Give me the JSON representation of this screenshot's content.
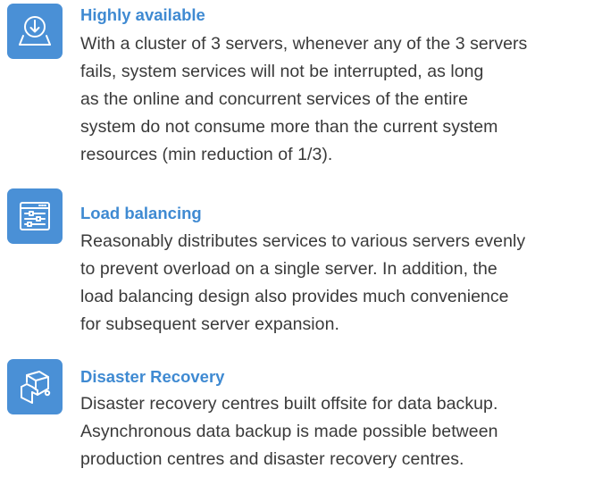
{
  "features": [
    {
      "icon": "download-tray-icon",
      "title": "Highly available",
      "body": "With a cluster of 3 servers, whenever any of the 3 servers\nfails, system services will not be interrupted, as long\nas the online and concurrent services of the entire\nsystem do not consume more than the current system\nresources (min reduction of 1/3)."
    },
    {
      "icon": "sliders-window-icon",
      "title": "Load balancing",
      "body": "Reasonably distributes services to various servers evenly\nto prevent overload on a single server. In addition, the\nload balancing design also provides much convenience\nfor subsequent server expansion."
    },
    {
      "icon": "backup-hand-icon",
      "title": "Disaster Recovery",
      "body": "Disaster recovery centres built offsite for data backup.\nAsynchronous data backup is made possible between\nproduction centres and disaster recovery centres."
    }
  ],
  "colors": {
    "accent": "#4a90d6",
    "title": "#3f8ad2",
    "body_text": "#3a3a3a",
    "background": "#ffffff"
  }
}
